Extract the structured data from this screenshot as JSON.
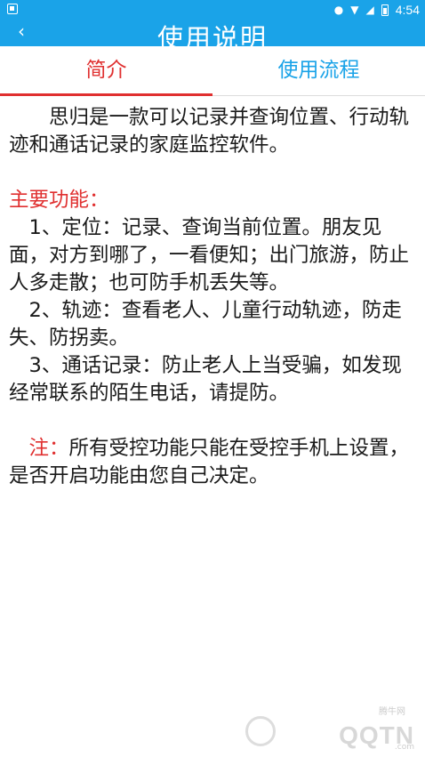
{
  "status_bar": {
    "time": "4:54",
    "icons": [
      "image-icon",
      "location-icon",
      "wifi-icon",
      "signal-icon",
      "battery-icon"
    ]
  },
  "header": {
    "back_icon": "chevron-left-icon",
    "title": "使用说明"
  },
  "tabs": [
    {
      "label": "简介",
      "active": true
    },
    {
      "label": "使用流程",
      "active": false
    }
  ],
  "content": {
    "intro": "思归是一款可以记录并查询位置、行动轨迹和通话记录的家庭监控软件。",
    "features_heading": "主要功能：",
    "features": [
      "1、定位：记录、查询当前位置。朋友见面，对方到哪了，一看便知；出门旅游，防止人多走散；也可防手机丢失等。",
      "2、轨迹：查看老人、儿童行动轨迹，防走失、防拐卖。",
      "3、通话记录：防止老人上当受骗，如发现经常联系的陌生电话，请提防。"
    ],
    "note_label": "注：",
    "note_text": "所有受控功能只能在受控手机上设置，是否开启功能由您自己决定。"
  },
  "watermark": {
    "site_name": "腾牛网",
    "logo_text": "QQTN",
    "domain_suffix": ".com"
  },
  "colors": {
    "primary": "#1aa3e8",
    "accent": "#e03030"
  }
}
